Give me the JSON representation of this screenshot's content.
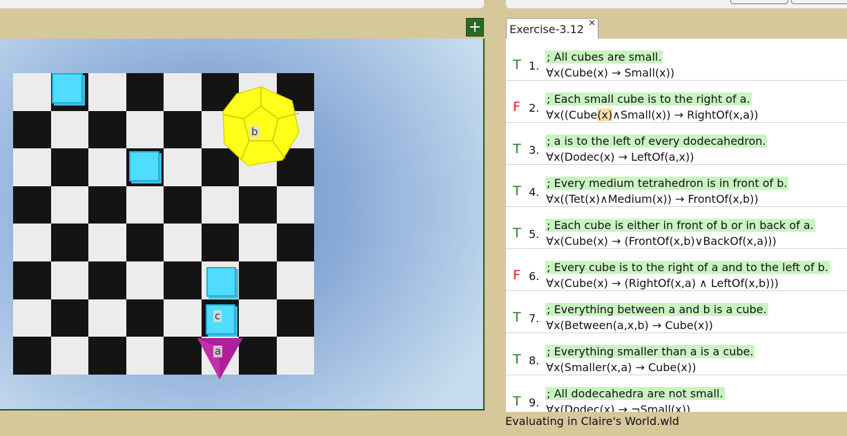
{
  "toolbar": {
    "add_label": "+"
  },
  "world": {
    "objects": [
      {
        "id": "b",
        "shape": "dodecahedron",
        "label": "b",
        "color": "#ffff00"
      },
      {
        "id": "c",
        "shape": "cube",
        "label": "c",
        "color": "#4fdcff"
      },
      {
        "id": "a",
        "shape": "tetrahedron",
        "label": "a",
        "color": "#b5209f"
      }
    ]
  },
  "tab": {
    "label": "Exercise-3.12",
    "close": "×"
  },
  "sentences": [
    {
      "truth": "T",
      "number": "1.",
      "comment": "; All cubes are small.",
      "formula": "∀x(Cube(x) → Small(x))"
    },
    {
      "truth": "F",
      "number": "2.",
      "comment": "; Each small cube is to the right of a.",
      "formula_pre": "∀x((Cube",
      "formula_hl": "(x)",
      "formula_post": "∧Small(x)) → RightOf(x,a))"
    },
    {
      "truth": "T",
      "number": "3.",
      "comment": "; a is to the left of every dodecahedron.",
      "formula": "∀x(Dodec(x) → LeftOf(a,x))"
    },
    {
      "truth": "T",
      "number": "4.",
      "comment": "; Every medium tetrahedron is in front of b.",
      "formula": "∀x((Tet(x)∧Medium(x)) → FrontOf(x,b))"
    },
    {
      "truth": "T",
      "number": "5.",
      "comment": "; Each cube is either in front of b or in back of a.",
      "formula": "∀x(Cube(x) → (FrontOf(x,b)∨BackOf(x,a)))"
    },
    {
      "truth": "F",
      "number": "6.",
      "comment": "; Every cube is to the right of a and to the left of b.",
      "formula": "∀x(Cube(x) → (RightOf(x,a) ∧ LeftOf(x,b)))"
    },
    {
      "truth": "T",
      "number": "7.",
      "comment": "; Everything between a and b is a cube.",
      "formula": "∀x(Between(a,x,b) → Cube(x))"
    },
    {
      "truth": "T",
      "number": "8.",
      "comment": "; Everything smaller than a is a cube.",
      "formula": "∀x(Smaller(x,a) → Cube(x))"
    },
    {
      "truth": "T",
      "number": "9.",
      "comment": "; All dodecahedra are not small.",
      "formula": "∀x(Dodec(x) → ¬Small(x))"
    }
  ],
  "status": {
    "text": "Evaluating in Claire's World.wld"
  }
}
